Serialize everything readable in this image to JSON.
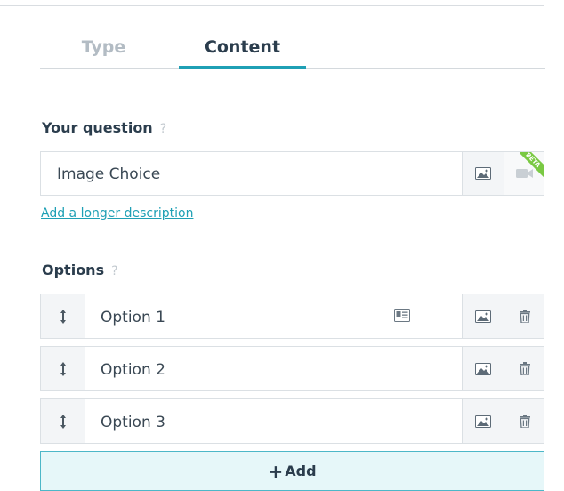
{
  "tabs": [
    {
      "label": "Type"
    },
    {
      "label": "Content"
    }
  ],
  "question": {
    "label": "Your question",
    "help": "?",
    "value": "Image Choice",
    "beta_badge": "BETA",
    "add_description": "Add a longer description"
  },
  "options": {
    "label": "Options",
    "help": "?",
    "items": [
      {
        "value": "Option 1"
      },
      {
        "value": "Option 2"
      },
      {
        "value": "Option 3"
      }
    ],
    "add_plus": "+",
    "add_label": "Add"
  },
  "colors": {
    "accent": "#1fa0b5",
    "add_bg": "#e6f7f9",
    "beta": "#7ac943"
  },
  "icons": [
    "image-icon",
    "video-icon",
    "drag-handle-icon",
    "trash-icon",
    "id-card-icon"
  ]
}
